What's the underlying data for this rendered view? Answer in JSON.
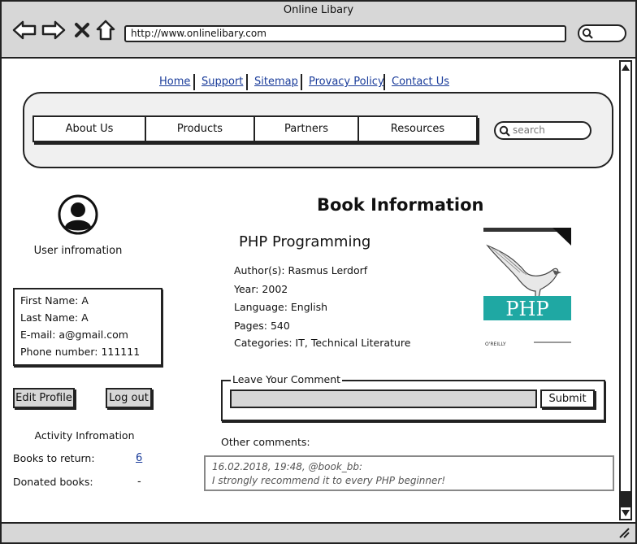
{
  "window": {
    "title": "Online Libary",
    "url": "http://www.onlinelibary.com"
  },
  "top_links": [
    "Home",
    "Support",
    "Sitemap",
    "Provacy Policy",
    "Contact Us"
  ],
  "nav": {
    "menu": [
      "About Us",
      "Products",
      "Partners",
      "Resources"
    ],
    "search_placeholder": "search"
  },
  "user": {
    "section_label": "User infromation",
    "first_name": "First Name: A",
    "last_name": "Last Name: A",
    "email": "E-mail: a@gmail.com",
    "phone": "Phone number: 111111",
    "edit_profile_label": "Edit Profile",
    "logout_label": "Log out"
  },
  "activity": {
    "title": "Activity Infromation",
    "books_to_return_label": "Books to return:",
    "books_to_return_value": "6",
    "donated_books_label": "Donated books:",
    "donated_books_value": "-"
  },
  "book": {
    "page_title": "Book Information",
    "title": "PHP Programming",
    "authors": "Author(s): Rasmus Lerdorf",
    "year": "Year: 2002",
    "language": "Language: English",
    "pages": "Pages: 540",
    "categories": "Categories: IT, Technical Literature",
    "cover_text": "PHP",
    "cover_publisher": "O'REILLY",
    "cover_color": "#1fa8a3"
  },
  "comments": {
    "legend": "Leave Your Comment",
    "input_value": "",
    "submit_label": "Submit",
    "other_label": "Other comments:",
    "items": [
      {
        "meta": "16.02.2018, 19:48, @book_bb:",
        "text": "I strongly recommend it to every PHP beginner!"
      }
    ]
  }
}
